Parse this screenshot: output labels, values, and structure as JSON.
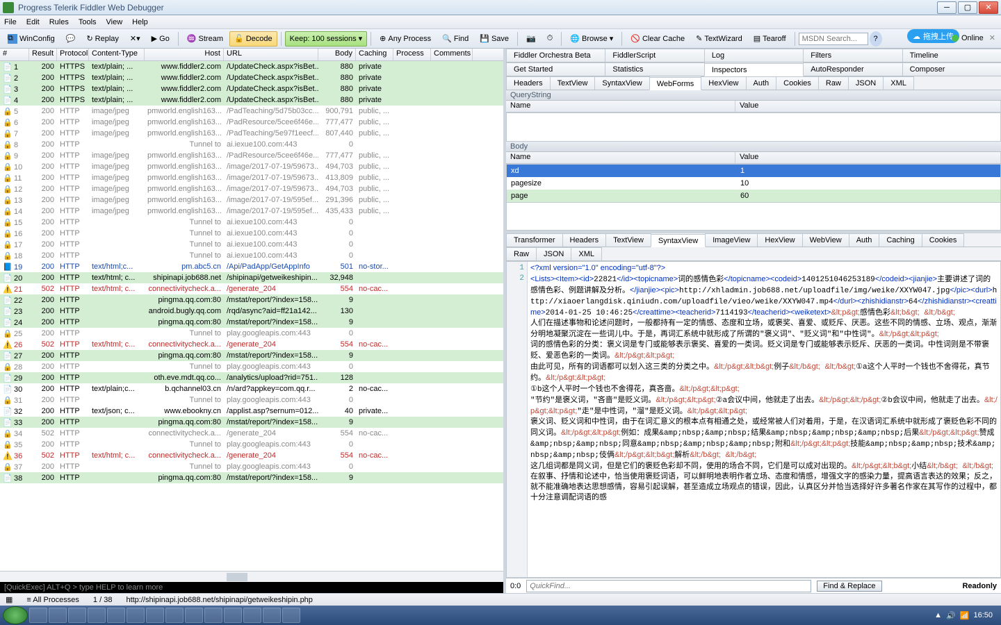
{
  "window": {
    "title": "Progress Telerik Fiddler Web Debugger"
  },
  "menu": [
    "File",
    "Edit",
    "Rules",
    "Tools",
    "View",
    "Help"
  ],
  "toolbar": {
    "replay": "Replay",
    "go": "Go",
    "stream": "Stream",
    "decode": "Decode",
    "keep": "Keep: 100 sessions",
    "anyproc": "Any Process",
    "find": "Find",
    "save": "Save",
    "browse": "Browse",
    "clear": "Clear Cache",
    "textwiz": "TextWizard",
    "tearoff": "Tearoff",
    "search_ph": "MSDN Search...",
    "online": "Online",
    "upload": "拖拽上传"
  },
  "sessCols": [
    "#",
    "Result",
    "Protocol",
    "Content-Type",
    "Host",
    "URL",
    "Body",
    "Caching",
    "Process",
    "Comments"
  ],
  "sessions": [
    {
      "n": 1,
      "r": 200,
      "p": "HTTPS",
      "ct": "text/plain; ...",
      "h": "www.fiddler2.com",
      "u": "/UpdateCheck.aspx?isBet...",
      "b": "880",
      "c": "private",
      "cls": "hl"
    },
    {
      "n": 2,
      "r": 200,
      "p": "HTTPS",
      "ct": "text/plain; ...",
      "h": "www.fiddler2.com",
      "u": "/UpdateCheck.aspx?isBet...",
      "b": "880",
      "c": "private",
      "cls": "hl"
    },
    {
      "n": 3,
      "r": 200,
      "p": "HTTPS",
      "ct": "text/plain; ...",
      "h": "www.fiddler2.com",
      "u": "/UpdateCheck.aspx?isBet...",
      "b": "880",
      "c": "private",
      "cls": "hl"
    },
    {
      "n": 4,
      "r": 200,
      "p": "HTTPS",
      "ct": "text/plain; ...",
      "h": "www.fiddler2.com",
      "u": "/UpdateCheck.aspx?isBet...",
      "b": "880",
      "c": "private",
      "cls": "hl"
    },
    {
      "n": 5,
      "r": 200,
      "p": "HTTP",
      "ct": "image/jpeg",
      "h": "pmworld.english163...",
      "u": "/PadTeaching/5d75b03cc...",
      "b": "900,791",
      "c": "public, ...",
      "cls": "gray"
    },
    {
      "n": 6,
      "r": 200,
      "p": "HTTP",
      "ct": "image/jpeg",
      "h": "pmworld.english163...",
      "u": "/PadResource/5cee6f46e...",
      "b": "777,477",
      "c": "public, ...",
      "cls": "gray"
    },
    {
      "n": 7,
      "r": 200,
      "p": "HTTP",
      "ct": "image/jpeg",
      "h": "pmworld.english163...",
      "u": "/PadTeaching/5e97f1eecf...",
      "b": "807,440",
      "c": "public, ...",
      "cls": "gray"
    },
    {
      "n": 8,
      "r": 200,
      "p": "HTTP",
      "ct": "",
      "h": "Tunnel to",
      "u": "ai.iexue100.com:443",
      "b": "0",
      "c": "",
      "cls": "gray"
    },
    {
      "n": 9,
      "r": 200,
      "p": "HTTP",
      "ct": "image/jpeg",
      "h": "pmworld.english163...",
      "u": "/PadResource/5cee6f46e...",
      "b": "777,477",
      "c": "public, ...",
      "cls": "gray"
    },
    {
      "n": 10,
      "r": 200,
      "p": "HTTP",
      "ct": "image/jpeg",
      "h": "pmworld.english163...",
      "u": "/image/2017-07-19/59673...",
      "b": "494,703",
      "c": "public, ...",
      "cls": "gray"
    },
    {
      "n": 11,
      "r": 200,
      "p": "HTTP",
      "ct": "image/jpeg",
      "h": "pmworld.english163...",
      "u": "/image/2017-07-19/59673...",
      "b": "413,809",
      "c": "public, ...",
      "cls": "gray"
    },
    {
      "n": 12,
      "r": 200,
      "p": "HTTP",
      "ct": "image/jpeg",
      "h": "pmworld.english163...",
      "u": "/image/2017-07-19/59673...",
      "b": "494,703",
      "c": "public, ...",
      "cls": "gray"
    },
    {
      "n": 13,
      "r": 200,
      "p": "HTTP",
      "ct": "image/jpeg",
      "h": "pmworld.english163...",
      "u": "/image/2017-07-19/595ef...",
      "b": "291,396",
      "c": "public, ...",
      "cls": "gray"
    },
    {
      "n": 14,
      "r": 200,
      "p": "HTTP",
      "ct": "image/jpeg",
      "h": "pmworld.english163...",
      "u": "/image/2017-07-19/595ef...",
      "b": "435,433",
      "c": "public, ...",
      "cls": "gray"
    },
    {
      "n": 15,
      "r": 200,
      "p": "HTTP",
      "ct": "",
      "h": "Tunnel to",
      "u": "ai.iexue100.com:443",
      "b": "0",
      "c": "",
      "cls": "gray"
    },
    {
      "n": 16,
      "r": 200,
      "p": "HTTP",
      "ct": "",
      "h": "Tunnel to",
      "u": "ai.iexue100.com:443",
      "b": "0",
      "c": "",
      "cls": "gray"
    },
    {
      "n": 17,
      "r": 200,
      "p": "HTTP",
      "ct": "",
      "h": "Tunnel to",
      "u": "ai.iexue100.com:443",
      "b": "0",
      "c": "",
      "cls": "gray"
    },
    {
      "n": 18,
      "r": 200,
      "p": "HTTP",
      "ct": "",
      "h": "Tunnel to",
      "u": "ai.iexue100.com:443",
      "b": "0",
      "c": "",
      "cls": "gray"
    },
    {
      "n": 19,
      "r": 200,
      "p": "HTTP",
      "ct": "text/html;c...",
      "h": "pm.abc5.cn",
      "u": "/Api/PadApp/GetAppInfo",
      "b": "501",
      "c": "no-stor...",
      "cls": "blue"
    },
    {
      "n": 20,
      "r": 200,
      "p": "HTTP",
      "ct": "text/html; c...",
      "h": "shipinapi.job688.net",
      "u": "/shipinapi/getweikeshipin...",
      "b": "32,948",
      "c": "",
      "cls": "hl"
    },
    {
      "n": 21,
      "r": 502,
      "p": "HTTP",
      "ct": "text/html; c...",
      "h": "connectivitycheck.a...",
      "u": "/generate_204",
      "b": "554",
      "c": "no-cac...",
      "cls": "red"
    },
    {
      "n": 22,
      "r": 200,
      "p": "HTTP",
      "ct": "",
      "h": "pingma.qq.com:80",
      "u": "/mstat/report/?index=158...",
      "b": "9",
      "c": "",
      "cls": "hl"
    },
    {
      "n": 23,
      "r": 200,
      "p": "HTTP",
      "ct": "",
      "h": "android.bugly.qq.com",
      "u": "/rqd/async?aid=ff21a142...",
      "b": "130",
      "c": "",
      "cls": "hl"
    },
    {
      "n": 24,
      "r": 200,
      "p": "HTTP",
      "ct": "",
      "h": "pingma.qq.com:80",
      "u": "/mstat/report/?index=158...",
      "b": "9",
      "c": "",
      "cls": "hl"
    },
    {
      "n": 25,
      "r": 200,
      "p": "HTTP",
      "ct": "",
      "h": "Tunnel to",
      "u": "play.googleapis.com:443",
      "b": "0",
      "c": "",
      "cls": "gray"
    },
    {
      "n": 26,
      "r": 502,
      "p": "HTTP",
      "ct": "text/html; c...",
      "h": "connectivitycheck.a...",
      "u": "/generate_204",
      "b": "554",
      "c": "no-cac...",
      "cls": "red"
    },
    {
      "n": 27,
      "r": 200,
      "p": "HTTP",
      "ct": "",
      "h": "pingma.qq.com:80",
      "u": "/mstat/report/?index=158...",
      "b": "9",
      "c": "",
      "cls": "hl"
    },
    {
      "n": 28,
      "r": 200,
      "p": "HTTP",
      "ct": "",
      "h": "Tunnel to",
      "u": "play.googleapis.com:443",
      "b": "0",
      "c": "",
      "cls": "gray"
    },
    {
      "n": 29,
      "r": 200,
      "p": "HTTP",
      "ct": "",
      "h": "oth.eve.mdt.qq.co...",
      "u": "/analytics/upload?rid=751...",
      "b": "128",
      "c": "",
      "cls": "hl"
    },
    {
      "n": 30,
      "r": 200,
      "p": "HTTP",
      "ct": "text/plain;c...",
      "h": "b.qchannel03.cn",
      "u": "/n/ard?appkey=com.qq.r...",
      "b": "2",
      "c": "no-cac...",
      "cls": ""
    },
    {
      "n": 31,
      "r": 200,
      "p": "HTTP",
      "ct": "",
      "h": "Tunnel to",
      "u": "play.googleapis.com:443",
      "b": "0",
      "c": "",
      "cls": "gray"
    },
    {
      "n": 32,
      "r": 200,
      "p": "HTTP",
      "ct": "text/json; c...",
      "h": "www.ebookny.cn",
      "u": "/applist.asp?sernum=012...",
      "b": "40",
      "c": "private...",
      "cls": ""
    },
    {
      "n": 33,
      "r": 200,
      "p": "HTTP",
      "ct": "",
      "h": "pingma.qq.com:80",
      "u": "/mstat/report/?index=158...",
      "b": "9",
      "c": "",
      "cls": "hl"
    },
    {
      "n": 34,
      "r": 502,
      "p": "HTTP",
      "ct": "",
      "h": "connectivitycheck.a...",
      "u": "/generate_204",
      "b": "554",
      "c": "no-cac...",
      "cls": "gray"
    },
    {
      "n": 35,
      "r": 200,
      "p": "HTTP",
      "ct": "",
      "h": "Tunnel to",
      "u": "play.googleapis.com:443",
      "b": "0",
      "c": "",
      "cls": "gray"
    },
    {
      "n": 36,
      "r": 502,
      "p": "HTTP",
      "ct": "text/html; c...",
      "h": "connectivitycheck.a...",
      "u": "/generate_204",
      "b": "554",
      "c": "no-cac...",
      "cls": "red"
    },
    {
      "n": 37,
      "r": 200,
      "p": "HTTP",
      "ct": "",
      "h": "Tunnel to",
      "u": "play.googleapis.com:443",
      "b": "0",
      "c": "",
      "cls": "gray"
    },
    {
      "n": 38,
      "r": 200,
      "p": "HTTP",
      "ct": "",
      "h": "pingma.qq.com:80",
      "u": "/mstat/report/?index=158...",
      "b": "9",
      "c": "",
      "cls": "hl"
    }
  ],
  "quickexec": "[QuickExec] ALT+Q > type HELP to learn more",
  "rightTabsTop": [
    "Fiddler Orchestra Beta",
    "FiddlerScript",
    "Log",
    "Filters",
    "Timeline"
  ],
  "rightTabsMid": [
    "Get Started",
    "Statistics",
    "Inspectors",
    "AutoResponder",
    "Composer"
  ],
  "reqTabs": [
    "Headers",
    "TextView",
    "SyntaxView",
    "WebForms",
    "HexView",
    "Auth",
    "Cookies",
    "Raw",
    "JSON",
    "XML"
  ],
  "reqActive": "WebForms",
  "qsLabel": "QueryString",
  "bodyLabel": "Body",
  "kvCols": {
    "name": "Name",
    "value": "Value"
  },
  "bodyParams": [
    {
      "n": "xd",
      "v": "1",
      "sel": true
    },
    {
      "n": "pagesize",
      "v": "10"
    },
    {
      "n": "page",
      "v": "60"
    }
  ],
  "respTabs": [
    "Transformer",
    "Headers",
    "TextView",
    "SyntaxView",
    "ImageView",
    "HexView",
    "WebView",
    "Auth",
    "Caching",
    "Cookies"
  ],
  "respTabs2": [
    "Raw",
    "JSON",
    "XML"
  ],
  "respActive": "SyntaxView",
  "xml": "<?xml version=\"1.0\" encoding=\"utf-8\"?>\n<Lists><Item><id>22821</id><topicname>词的感情色彩</topicname><codeid>1401251046253189</codeid><jianjie>主要讲述了词的感情色彩、例题讲解及分析。</jianjie><pic>http://xhladmin.job688.net/uploadfile/img/weike/XXYW047.jpg</pic><durl>http://xiaoerlangdisk.qiniudn.com/uploadfile/vieo/weike/XXYW047.mp4</durl><zhishidianstr>64</zhishidianstr><creattime>2014-01-25 10:46:25</creattime><teacherid>7114193</teacherid><weiketext>&lt;p&gt;感情色彩&lt;b&gt; &lt;/b&gt;\n人们在描述事物和论述问题时，一般都持有一定的情感、态度和立场，或褒奖、喜爱、或贬斥、厌恶。这些不同的情感、立场、观点，渐渐分明地凝聚沉淀在一些词儿中。于是，再词汇系统中就形成了所谓的\"褒义词\"、\"贬义词\"和\"中性词\"。&lt;/p&gt;&lt;p&gt;\n词的感情色彩的分类：褒义词是专门或能够表示褒奖、喜爱的一类词。贬义词是专门或能够表示贬斥、厌恶的一类词。中性词则是不带褒贬、爱恶色彩的一类词。&lt;/p&gt;&lt;p&gt;\n由此可见，所有的词语都可以划入这三类的分类之中。&lt;/p&gt;&lt;b&gt;例子&lt;/b&gt; &lt;/b&gt;①a这个人平时一个钱也不舍得花，真节约。&lt;/p&gt;&lt;p&gt;\n①b这个人平时一个钱也不舍得花，真吝啬。&lt;/p&gt;&lt;p&gt;\n\"节约\"是褒义词，\"吝啬\"是贬义词。&lt;/p&gt;&lt;p&gt;②a会议中间，他就走了出去。&lt;/p&gt;&lt;/p&gt;②b会议中间，他就走了出去。&lt;/p&gt;&lt;p&gt;\"走\"是中性词，\"溜\"是贬义词。&lt;/p&gt;&lt;p&gt;\n褒义词、贬义词和中性词，由于在词汇意义的根本点有相通之处，或经常被人们对着用，于是，在汉语词汇系统中就形成了褒贬色彩不同的同义词。&lt;/p&gt;&lt;p&gt;例如：成果&amp;nbsp;&amp;nbsp;结果&amp;nbsp;&amp;nbsp;&amp;nbsp;后果&lt;/p&gt;&lt;p&gt;赞成&amp;nbsp;&amp;nbsp;同意&amp;nbsp;&amp;nbsp;&amp;nbsp;附和&lt;/p&gt;&lt;p&gt;技能&amp;nbsp;&amp;nbsp;技术&amp;nbsp;&amp;nbsp;伎俩&lt;/p&gt;&lt;b&gt;解析&lt;/b&gt; &lt;/b&gt;\n这几组词都是同义词，但是它们的褒贬色彩却不同，使用的场合不同，它们是可以成对出现的。&lt;/p&gt;&lt;b&gt;小结&lt;/b&gt; &lt;/b&gt;\n在叙事、抒情和论述中，恰当使用褒贬词语，可以鲜明地表明作者立场、态度和情感，增强文字的感染力量，提高语言表达的效果；反之，就不能准确地表达思想感情，容易引起误解，甚至造成立场观点的错误，因此，认真区分并恰当选择好许多著名作家在其写作的过程中，都十分注意调配词语的感",
  "bottom": {
    "pos": "0:0",
    "qf_ph": "QuickFind...",
    "fr": "Find & Replace",
    "ro": "Readonly"
  },
  "status": {
    "proc": "All Processes",
    "count": "1 / 38",
    "url": "http://shipinapi.job688.net/shipinapi/getweikeshipin.php"
  },
  "clock": "16:50"
}
